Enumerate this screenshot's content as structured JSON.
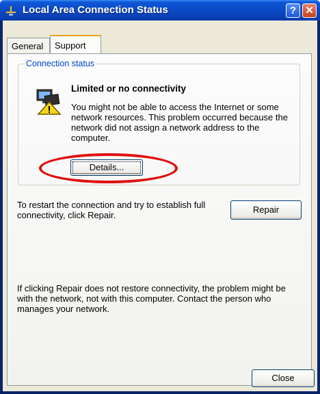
{
  "window": {
    "title": "Local Area Connection Status",
    "help_glyph": "?",
    "close_glyph": "✕"
  },
  "tabs": [
    {
      "label": "General",
      "selected": false
    },
    {
      "label": "Support",
      "selected": true
    }
  ],
  "connection_status": {
    "group_label": "Connection status",
    "heading": "Limited or no connectivity",
    "description": "You might not be able to access the Internet or some network resources. This problem occurred because the network did not assign a network address to the computer.",
    "details_button": "Details..."
  },
  "repair_section": {
    "text": "To restart the connection and try to establish full connectivity, click Repair.",
    "repair_button": "Repair"
  },
  "footer_text": "If clicking Repair does not restore connectivity, the problem might be with the network, not with this computer. Contact the person who manages your network.",
  "close_button": "Close",
  "colors": {
    "title_bar": "#0a49c4",
    "highlight_ellipse": "#e01010",
    "group_label": "#0046d5",
    "tab_accent": "#e9a51e"
  },
  "icons": {
    "title": "network-connection-icon",
    "status": "network-warning-icon"
  }
}
